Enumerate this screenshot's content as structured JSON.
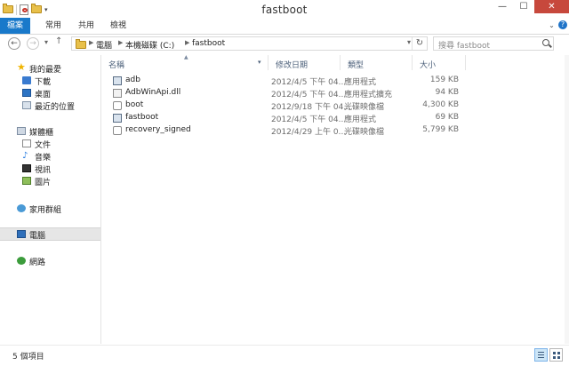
{
  "window": {
    "title": "fastboot"
  },
  "window_controls": {
    "minimize": "—",
    "maximize": "☐",
    "close": "✕"
  },
  "ribbon": {
    "tabs": [
      "檔案",
      "常用",
      "共用",
      "檢視"
    ],
    "help": "?"
  },
  "address": {
    "crumbs": [
      "電腦",
      "本機磁碟 (C:)",
      "fastboot"
    ]
  },
  "search": {
    "placeholder": "搜尋 fastboot"
  },
  "sidebar": {
    "favorites": "我的最愛",
    "downloads": "下載",
    "desktop": "桌面",
    "recent": "最近的位置",
    "libraries": "媒體櫃",
    "documents": "文件",
    "music": "音樂",
    "videos": "視訊",
    "pictures": "圖片",
    "homegroup": "家用群組",
    "computer": "電腦",
    "network": "網路"
  },
  "columns": [
    "名稱",
    "修改日期",
    "類型",
    "大小"
  ],
  "files": [
    {
      "name": "adb",
      "date": "2012/4/5 下午 04...",
      "type": "應用程式",
      "size": "159 KB",
      "kind": "exe"
    },
    {
      "name": "AdbWinApi.dll",
      "date": "2012/4/5 下午 04...",
      "type": "應用程式擴充",
      "size": "94 KB",
      "kind": "dll"
    },
    {
      "name": "boot",
      "date": "2012/9/18 下午 04...",
      "type": "光碟映像檔",
      "size": "4,300 KB",
      "kind": "img"
    },
    {
      "name": "fastboot",
      "date": "2012/4/5 下午 04...",
      "type": "應用程式",
      "size": "69 KB",
      "kind": "exe"
    },
    {
      "name": "recovery_signed",
      "date": "2012/4/29 上午 0...",
      "type": "光碟映像檔",
      "size": "5,799 KB",
      "kind": "img"
    }
  ],
  "status": {
    "count": "5 個項目"
  }
}
